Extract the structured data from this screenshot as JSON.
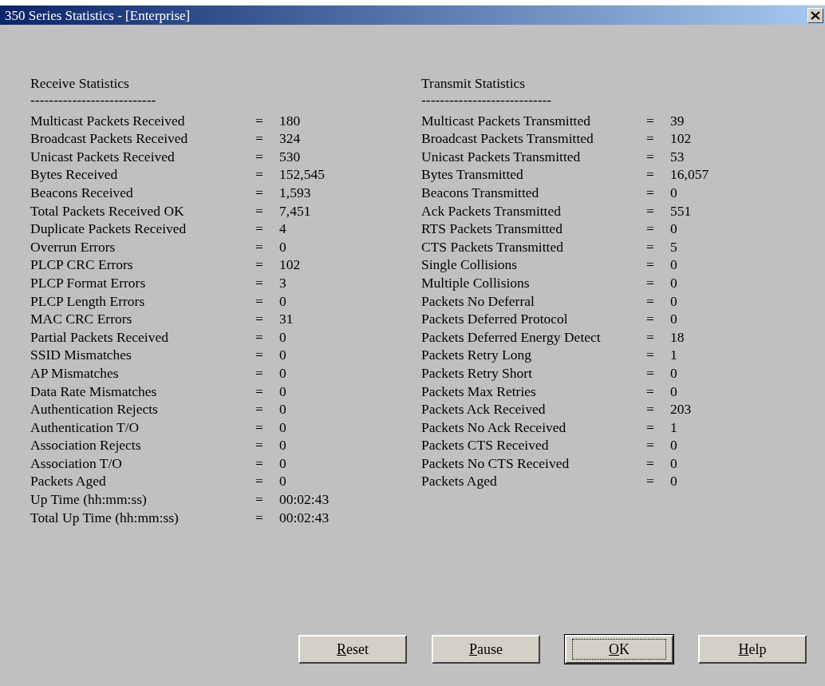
{
  "window": {
    "title": "350 Series Statistics - [Enterprise]"
  },
  "sections": [
    {
      "heading": "Receive Statistics",
      "rule": "---------------------------",
      "rows": [
        {
          "label": "Multicast Packets Received",
          "sep": "=",
          "value": "180"
        },
        {
          "label": "Broadcast Packets Received",
          "sep": "=",
          "value": "324"
        },
        {
          "label": "Unicast Packets Received",
          "sep": "=",
          "value": "530"
        },
        {
          "label": "Bytes Received",
          "sep": "=",
          "value": "152,545"
        },
        {
          "label": "Beacons Received",
          "sep": "=",
          "value": "1,593"
        },
        {
          "label": "Total Packets Received OK",
          "sep": "=",
          "value": "7,451"
        },
        {
          "label": "Duplicate Packets Received",
          "sep": "=",
          "value": "4"
        },
        {
          "label": "Overrun Errors",
          "sep": "=",
          "value": "0"
        },
        {
          "label": "PLCP CRC Errors",
          "sep": "=",
          "value": "102"
        },
        {
          "label": "PLCP Format Errors",
          "sep": "=",
          "value": "3"
        },
        {
          "label": "PLCP Length Errors",
          "sep": "=",
          "value": "0"
        },
        {
          "label": "MAC CRC Errors",
          "sep": "=",
          "value": "31"
        },
        {
          "label": "Partial Packets Received",
          "sep": "=",
          "value": "0"
        },
        {
          "label": "SSID Mismatches",
          "sep": "=",
          "value": "0"
        },
        {
          "label": "AP Mismatches",
          "sep": "=",
          "value": "0"
        },
        {
          "label": "Data Rate Mismatches",
          "sep": "=",
          "value": "0"
        },
        {
          "label": "Authentication Rejects",
          "sep": "=",
          "value": "0"
        },
        {
          "label": "Authentication T/O",
          "sep": "=",
          "value": "0"
        },
        {
          "label": "Association Rejects",
          "sep": "=",
          "value": "0"
        },
        {
          "label": "Association T/O",
          "sep": "=",
          "value": "0"
        },
        {
          "label": "Packets Aged",
          "sep": "=",
          "value": "0"
        },
        {
          "label": "Up Time (hh:mm:ss)",
          "sep": "=",
          "value": "00:02:43"
        },
        {
          "label": "Total Up Time (hh:mm:ss)",
          "sep": "=",
          "value": "00:02:43"
        }
      ]
    },
    {
      "heading": "Transmit Statistics",
      "rule": "----------------------------",
      "rows": [
        {
          "label": "Multicast Packets Transmitted",
          "sep": "=",
          "value": "39"
        },
        {
          "label": "Broadcast Packets Transmitted",
          "sep": "=",
          "value": "102"
        },
        {
          "label": "Unicast Packets Transmitted",
          "sep": "=",
          "value": "53"
        },
        {
          "label": "Bytes Transmitted",
          "sep": "=",
          "value": "16,057"
        },
        {
          "label": "Beacons Transmitted",
          "sep": "=",
          "value": "0"
        },
        {
          "label": "Ack Packets Transmitted",
          "sep": "=",
          "value": "551"
        },
        {
          "label": "RTS Packets Transmitted",
          "sep": "=",
          "value": "0"
        },
        {
          "label": "CTS Packets Transmitted",
          "sep": "=",
          "value": "5"
        },
        {
          "label": "Single Collisions",
          "sep": "=",
          "value": "0"
        },
        {
          "label": "Multiple Collisions",
          "sep": "=",
          "value": "0"
        },
        {
          "label": "Packets No Deferral",
          "sep": "=",
          "value": "0"
        },
        {
          "label": "Packets Deferred Protocol",
          "sep": "=",
          "value": "0"
        },
        {
          "label": "Packets Deferred Energy Detect",
          "sep": "=",
          "value": "18"
        },
        {
          "label": "Packets Retry Long",
          "sep": "=",
          "value": "1"
        },
        {
          "label": "Packets Retry Short",
          "sep": "=",
          "value": "0"
        },
        {
          "label": "Packets Max Retries",
          "sep": "=",
          "value": "0"
        },
        {
          "label": "Packets Ack Received",
          "sep": "=",
          "value": "203"
        },
        {
          "label": "Packets No Ack Received",
          "sep": "=",
          "value": "1"
        },
        {
          "label": "Packets CTS Received",
          "sep": "=",
          "value": "0"
        },
        {
          "label": "Packets No CTS Received",
          "sep": "=",
          "value": "0"
        },
        {
          "label": "Packets Aged",
          "sep": "=",
          "value": "0"
        }
      ]
    }
  ],
  "buttons": [
    {
      "access_key": "R",
      "rest": "eset",
      "default": false
    },
    {
      "access_key": "P",
      "rest": "ause",
      "default": false
    },
    {
      "access_key": "O",
      "rest": "K",
      "default": true
    },
    {
      "access_key": "H",
      "rest": "elp",
      "default": false
    }
  ]
}
